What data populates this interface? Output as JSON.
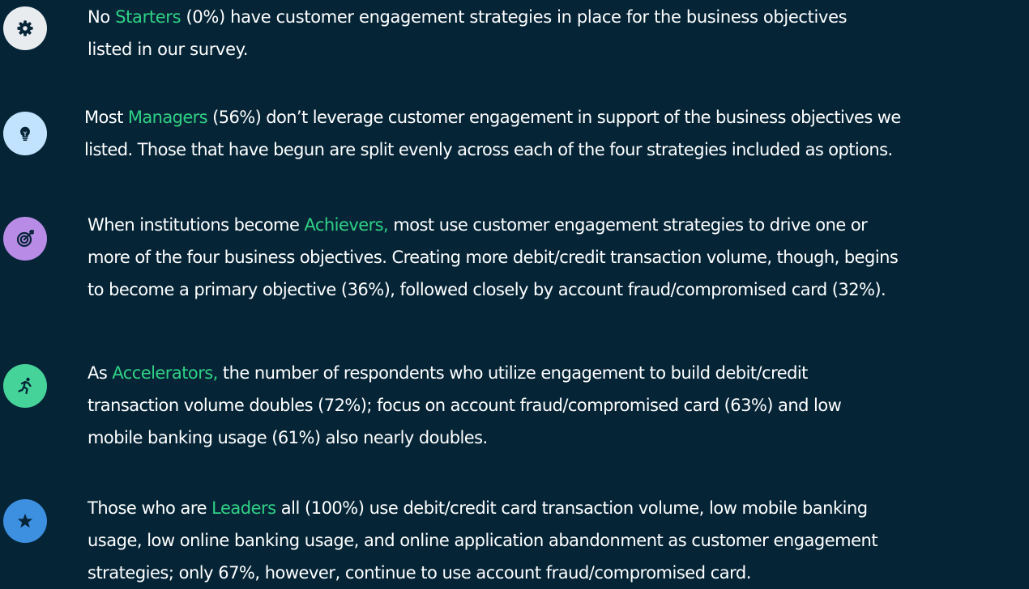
{
  "colors": {
    "background": "#052537",
    "text": "#ffffff",
    "highlight": "#2ed184",
    "icon_gear_bg": "#e9ecef",
    "icon_lightbulb_bg": "#c2e3ff",
    "icon_target_bg": "#b88be6",
    "icon_runner_bg": "#46d39a",
    "icon_star_bg": "#3d8fe0"
  },
  "items": [
    {
      "icon": "gear-icon",
      "lines": [
        {
          "pre": "No ",
          "hl": "Starters",
          "post": " (0%) have customer engagement strategies in place for the business objectives"
        },
        {
          "text": "listed in our survey."
        }
      ]
    },
    {
      "icon": "lightbulb-icon",
      "lines": [
        {
          "pre": "Most ",
          "hl": "Managers",
          "post": " (56%) don’t leverage customer engagement in support of the business objectives we"
        },
        {
          "text": "listed. Those that have begun are split evenly across each of the four strategies included as options."
        }
      ]
    },
    {
      "icon": "target-icon",
      "lines": [
        {
          "pre": "When institutions become ",
          "hl": "Achievers,",
          "post": " most use customer engagement strategies to drive one or"
        },
        {
          "text": "more of the four business objectives. Creating more debit/credit transaction volume, though, begins"
        },
        {
          "text": "to become a primary objective (36%), followed closely by account fraud/compromised card (32%)."
        }
      ]
    },
    {
      "icon": "runner-icon",
      "lines": [
        {
          "pre": "As ",
          "hl": "Accelerators,",
          "post": " the number of respondents who utilize engagement to build debit/credit"
        },
        {
          "text": "transaction volume doubles (72%); focus on account fraud/compromised card (63%) and low"
        },
        {
          "text": "mobile banking usage (61%) also nearly doubles."
        }
      ]
    },
    {
      "icon": "star-icon",
      "lines": [
        {
          "pre": "Those who are ",
          "hl": "Leaders",
          "post": " all (100%) use debit/credit card transaction volume, low mobile banking"
        },
        {
          "text": "usage, low online banking usage, and online application abandonment as customer engagement"
        },
        {
          "text": "strategies; only 67%, however, continue to use account fraud/compromised card."
        }
      ]
    }
  ]
}
